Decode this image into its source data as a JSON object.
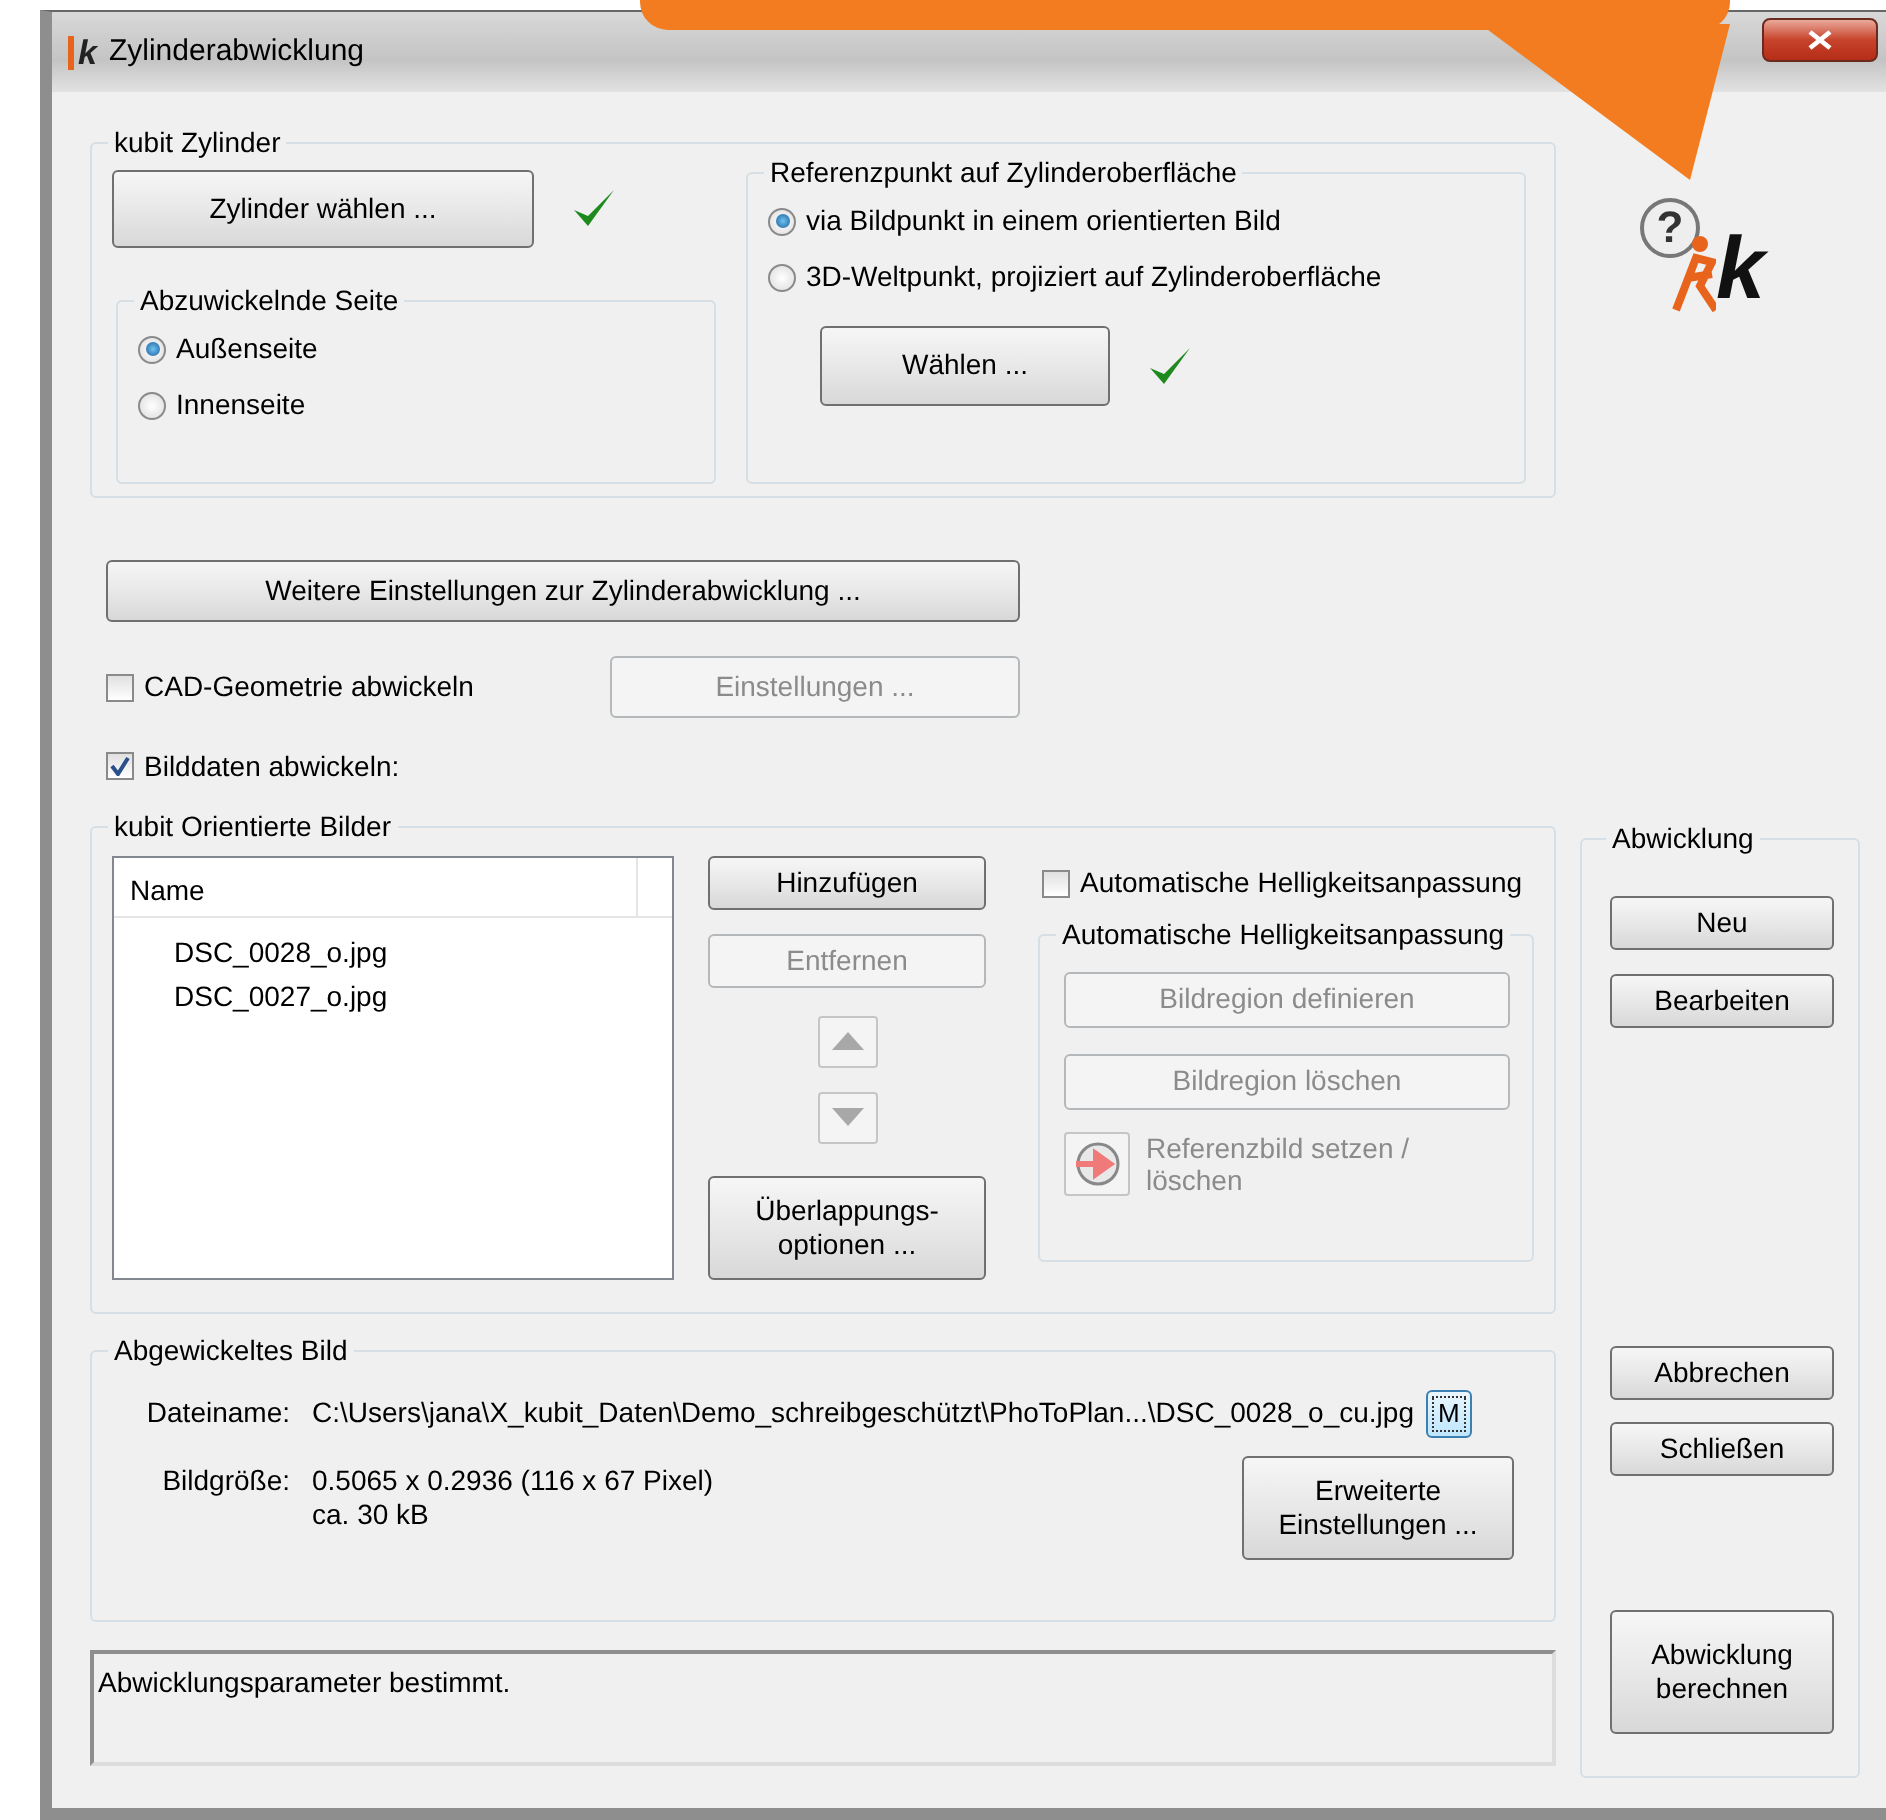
{
  "window": {
    "title": "Zylinderabwicklung",
    "icon_text": "k"
  },
  "logo": {
    "help_mark": "?",
    "text": "k"
  },
  "cylinder_group": {
    "title": "kubit Zylinder",
    "select_button": "Zylinder wählen ...",
    "done": true,
    "side_group": {
      "title": "Abzuwickelnde Seite",
      "options": [
        {
          "label": "Außenseite",
          "selected": true
        },
        {
          "label": "Innenseite",
          "selected": false
        }
      ]
    },
    "reference_group": {
      "title": "Referenzpunkt auf Zylinderoberfläche",
      "options": [
        {
          "label": "via Bildpunkt in einem orientierten Bild",
          "selected": true
        },
        {
          "label": "3D-Weltpunkt, projiziert auf Zylinderoberfläche",
          "selected": false
        }
      ],
      "select_button": "Wählen ...",
      "done": true
    }
  },
  "more_settings_button": "Weitere Einstellungen zur Zylinderabwicklung ...",
  "cad_option": {
    "label": "CAD-Geometrie abwickeln",
    "checked": false,
    "settings_button": "Einstellungen ...",
    "settings_disabled": true
  },
  "image_option": {
    "label": "Bilddaten abwickeln:",
    "checked": true
  },
  "images_group": {
    "title": "kubit Orientierte Bilder",
    "columns": [
      "Name"
    ],
    "rows": [
      "DSC_0028_o.jpg",
      "DSC_0027_o.jpg"
    ],
    "buttons": [
      {
        "label": "Hinzufügen",
        "disabled": false
      },
      {
        "label": "Entfernen",
        "disabled": true
      }
    ],
    "move_disabled": true,
    "overlap_button": "Überlappungs-\noptionen ...",
    "auto_brightness": {
      "label": "Automatische Helligkeitsanpassung",
      "checked": false
    },
    "brightness_group": {
      "title": "Automatische Helligkeitsanpassung",
      "disabled": true,
      "buttons": [
        "Bildregion definieren",
        "Bildregion löschen"
      ],
      "reference_label": "Referenzbild setzen /\nlöschen"
    }
  },
  "result_group": {
    "title": "Abgewickeltes Bild",
    "fields": [
      {
        "label": "Dateiname:",
        "value": "C:\\Users\\jana\\X_kubit_Daten\\Demo_schreibgeschützt\\PhoToPlan...\\DSC_0028_o_cu.jpg"
      },
      {
        "label": "Bildgröße:",
        "value": "0.5065 x 0.2936 (116 x 67 Pixel)\nca. 30 kB"
      }
    ],
    "m_button": "M",
    "advanced_button": "Erweiterte\nEinstellungen ..."
  },
  "status_text": "Abwicklungsparameter bestimmt.",
  "side_panel": {
    "title": "Abwicklung",
    "top_buttons": [
      "Neu",
      "Bearbeiten"
    ],
    "bottom_buttons": [
      "Abbrechen",
      "Schließen"
    ],
    "compute_button": "Abwicklung\nberechnen"
  }
}
